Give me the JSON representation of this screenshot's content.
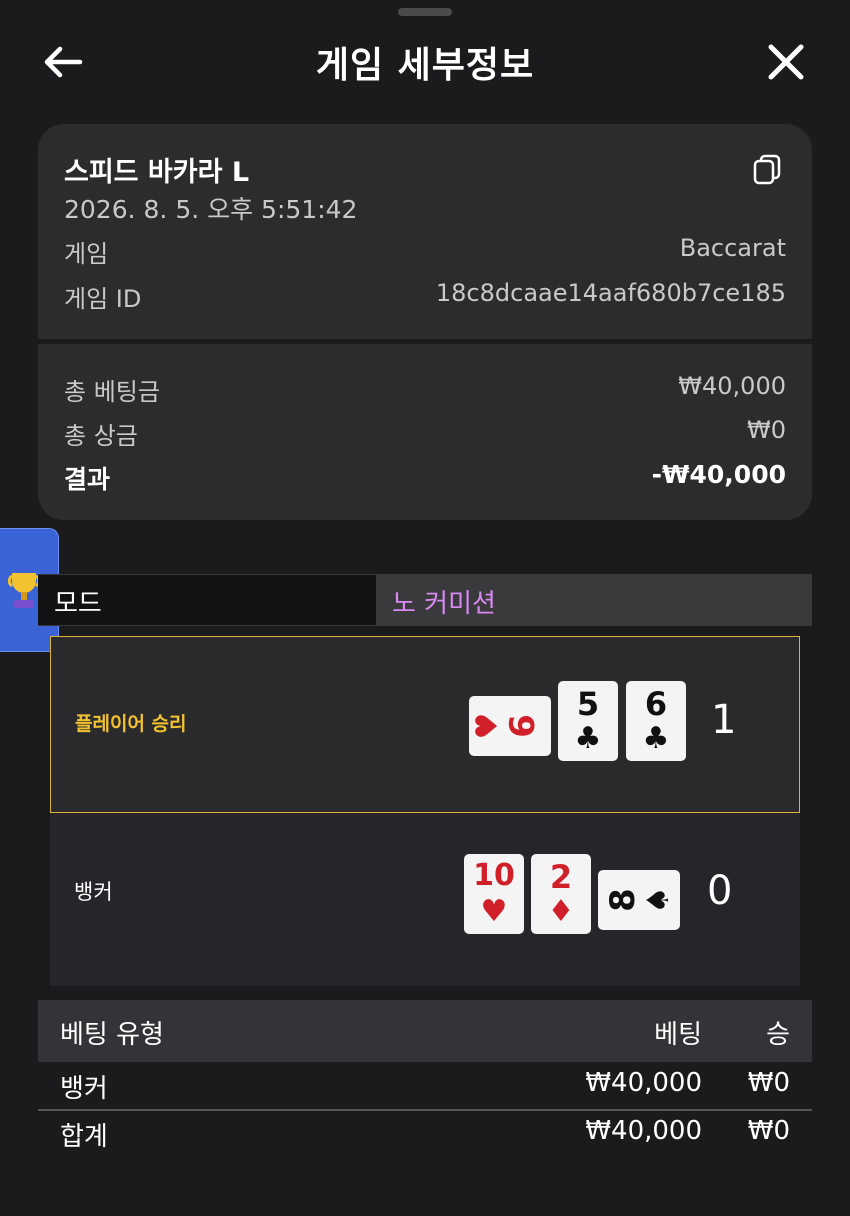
{
  "header": {
    "title": "게임 세부정보"
  },
  "summary": {
    "game_name": "스피드 바카라 L",
    "datetime": "2026. 8. 5. 오후 5:51:42",
    "rows": [
      {
        "label": "게임",
        "value": "Baccarat"
      },
      {
        "label": "게임 ID",
        "value": "18c8dcaae14aaf680b7ce185"
      }
    ],
    "totals": [
      {
        "label": "총 베팅금",
        "value": "₩40,000"
      },
      {
        "label": "총 상금",
        "value": "₩0"
      },
      {
        "label": "결과",
        "value": "-₩40,000"
      }
    ]
  },
  "mode": {
    "label": "모드",
    "value": "노 커미션"
  },
  "result": {
    "player": {
      "label": "플레이어 승리",
      "score": "1",
      "cards": [
        {
          "rank": "6",
          "suit": "♥",
          "color": "red",
          "orientation": "sideways"
        },
        {
          "rank": "5",
          "suit": "♣",
          "color": "black",
          "orientation": "upright"
        },
        {
          "rank": "6",
          "suit": "♣",
          "color": "black",
          "orientation": "upright"
        }
      ]
    },
    "banker": {
      "label": "뱅커",
      "score": "0",
      "cards": [
        {
          "rank": "10",
          "suit": "♥",
          "color": "red",
          "orientation": "upright"
        },
        {
          "rank": "2",
          "suit": "♦",
          "color": "red",
          "orientation": "upright"
        },
        {
          "rank": "8",
          "suit": "♠",
          "color": "black",
          "orientation": "sideways"
        }
      ]
    }
  },
  "bets": {
    "headers": [
      "베팅 유형",
      "베팅",
      "승"
    ],
    "rows": [
      {
        "type": "뱅커",
        "bet": "₩40,000",
        "win": "₩0"
      }
    ],
    "total": {
      "type": "합계",
      "bet": "₩40,000",
      "win": "₩0"
    }
  },
  "colors": {
    "accent_gold": "#d9b23a",
    "mode_value": "#d789f0",
    "card_red": "#d11f2a",
    "tab_blue": "#3a64d6"
  },
  "icons": [
    "back-arrow-icon",
    "close-icon",
    "copy-icon",
    "trophy-icon"
  ]
}
